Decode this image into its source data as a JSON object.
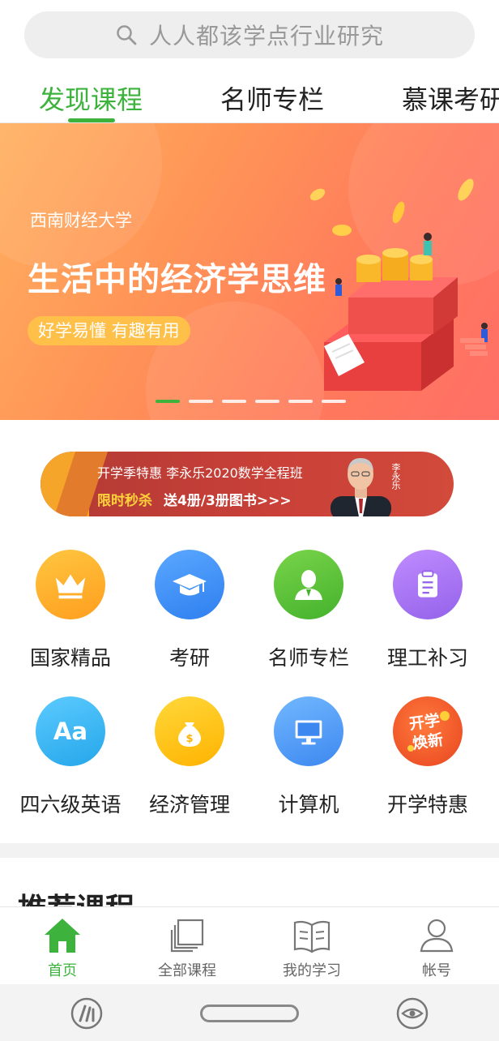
{
  "search": {
    "placeholder": "人人都该学点行业研究",
    "icon": "search-icon"
  },
  "tabs": [
    {
      "label": "发现课程",
      "active": true
    },
    {
      "label": "名师专栏",
      "active": false
    },
    {
      "label": "慕课考研",
      "active": false
    }
  ],
  "banner": {
    "university": "西南财经大学",
    "title": "生活中的经济学思维",
    "tag": "好学易懂 有趣有用",
    "slide_count": 6,
    "active_slide": 1
  },
  "promo": {
    "line1": "开学季特惠 李永乐2020数学全程班",
    "highlight": "限时秒杀",
    "offer": "送4册/3册图书>>>",
    "teacher": "李永乐"
  },
  "categories": [
    {
      "label": "国家精品",
      "icon": "crown-icon",
      "color": "#ffa826"
    },
    {
      "label": "考研",
      "icon": "graduation-cap-icon",
      "color": "#3d8ff5"
    },
    {
      "label": "名师专栏",
      "icon": "teacher-icon",
      "color": "#58c23a"
    },
    {
      "label": "理工补习",
      "icon": "clipboard-icon",
      "color": "#a773f0"
    },
    {
      "label": "四六级英语",
      "icon": "letters-aa-icon",
      "color": "#3cb8f0"
    },
    {
      "label": "经济管理",
      "icon": "money-bag-icon",
      "color": "#ffc21a"
    },
    {
      "label": "计算机",
      "icon": "monitor-icon",
      "color": "#4c9cf5"
    },
    {
      "label": "开学特惠",
      "icon": "promo-badge-icon",
      "color": "#f0602e",
      "badge_text": "开学焕新"
    }
  ],
  "recommend": {
    "title": "推荐课程"
  },
  "bottom_nav": [
    {
      "label": "首页",
      "icon": "home-icon",
      "active": true
    },
    {
      "label": "全部课程",
      "icon": "courses-icon",
      "active": false
    },
    {
      "label": "我的学习",
      "icon": "book-icon",
      "active": false
    },
    {
      "label": "帐号",
      "icon": "user-icon",
      "active": false
    }
  ],
  "colors": {
    "accent": "#3db33d"
  }
}
